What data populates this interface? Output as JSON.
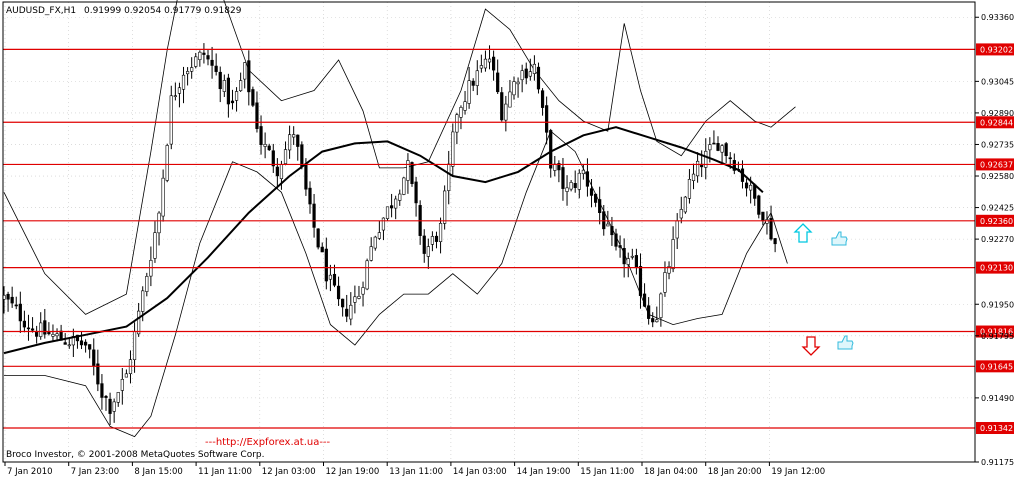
{
  "header": {
    "symbol": "AUDUSD_FX,H1",
    "ohlc": "0.91999 0.92054 0.91779 0.91829"
  },
  "footer": {
    "copyright": "Broco Investor, © 2001-2008 MetaQuotes Software Corp.",
    "watermark": "---http://Expforex.at.ua---"
  },
  "colors": {
    "candle": "#000000",
    "level_line": "#e00000",
    "label_bg": "#e00000",
    "grid": "#c8c8c8",
    "up_arrow": "#00c8e0",
    "down_arrow": "#e00000",
    "hand": "#33bbdd"
  },
  "icons": {
    "up": "arrow-up-icon",
    "down": "arrow-down-icon",
    "hand": "thumb-up-hand-icon"
  },
  "chart_data": {
    "type": "candlestick",
    "ylim": [
      0.91175,
      0.9343
    ],
    "y_ticks": [
      "0.93360",
      "0.93045",
      "0.92890",
      "0.92735",
      "0.92580",
      "0.92425",
      "0.92270",
      "0.91950",
      "0.91795",
      "0.91490",
      "0.91175"
    ],
    "x_ticks": [
      "7 Jan 2010",
      "7 Jan 23:00",
      "8 Jan 15:00",
      "11 Jan 11:00",
      "12 Jan 03:00",
      "12 Jan 19:00",
      "13 Jan 11:00",
      "14 Jan 03:00",
      "14 Jan 19:00",
      "15 Jan 11:00",
      "18 Jan 04:00",
      "18 Jan 20:00",
      "19 Jan 12:00"
    ],
    "levels": [
      "0.93202",
      "0.92844",
      "0.92637",
      "0.92360",
      "0.92130",
      "0.91816",
      "0.91645",
      "0.91342"
    ],
    "bars_count": 190,
    "close_path": [
      [
        0,
        0.9198
      ],
      [
        7,
        0.9183
      ],
      [
        14,
        0.9178
      ],
      [
        20,
        0.9175
      ],
      [
        24,
        0.9152
      ],
      [
        26,
        0.9145
      ],
      [
        30,
        0.916
      ],
      [
        34,
        0.92
      ],
      [
        38,
        0.924
      ],
      [
        41,
        0.9295
      ],
      [
        44,
        0.931
      ],
      [
        49,
        0.9318
      ],
      [
        53,
        0.9305
      ],
      [
        56,
        0.9292
      ],
      [
        59,
        0.931
      ],
      [
        63,
        0.9275
      ],
      [
        67,
        0.9262
      ],
      [
        71,
        0.928
      ],
      [
        75,
        0.924
      ],
      [
        79,
        0.921
      ],
      [
        83,
        0.919
      ],
      [
        87,
        0.92
      ],
      [
        91,
        0.923
      ],
      [
        95,
        0.9245
      ],
      [
        99,
        0.9262
      ],
      [
        103,
        0.922
      ],
      [
        107,
        0.9232
      ],
      [
        111,
        0.929
      ],
      [
        115,
        0.9305
      ],
      [
        119,
        0.9316
      ],
      [
        122,
        0.929
      ],
      [
        126,
        0.9308
      ],
      [
        130,
        0.9312
      ],
      [
        134,
        0.9265
      ],
      [
        138,
        0.925
      ],
      [
        142,
        0.926
      ],
      [
        146,
        0.924
      ],
      [
        150,
        0.922
      ],
      [
        154,
        0.9215
      ],
      [
        158,
        0.919
      ],
      [
        160,
        0.919
      ],
      [
        163,
        0.9215
      ],
      [
        167,
        0.925
      ],
      [
        171,
        0.9265
      ],
      [
        175,
        0.9275
      ],
      [
        179,
        0.9265
      ],
      [
        183,
        0.925
      ],
      [
        186,
        0.924
      ],
      [
        189,
        0.9225
      ],
      [
        192,
        0.92
      ],
      [
        194,
        0.9183
      ]
    ],
    "ma_path": [
      [
        0,
        0.9171
      ],
      [
        10,
        0.9176
      ],
      [
        20,
        0.918
      ],
      [
        30,
        0.9184
      ],
      [
        40,
        0.9198
      ],
      [
        50,
        0.9218
      ],
      [
        60,
        0.924
      ],
      [
        70,
        0.9258
      ],
      [
        78,
        0.927
      ],
      [
        86,
        0.9274
      ],
      [
        94,
        0.9275
      ],
      [
        102,
        0.9268
      ],
      [
        110,
        0.9258
      ],
      [
        118,
        0.9255
      ],
      [
        126,
        0.926
      ],
      [
        134,
        0.927
      ],
      [
        142,
        0.9278
      ],
      [
        150,
        0.9282
      ],
      [
        158,
        0.9277
      ],
      [
        166,
        0.9272
      ],
      [
        174,
        0.9266
      ],
      [
        180,
        0.9261
      ],
      [
        186,
        0.925
      ]
    ],
    "band_upper": [
      [
        0,
        0.925
      ],
      [
        10,
        0.921
      ],
      [
        20,
        0.919
      ],
      [
        30,
        0.92
      ],
      [
        36,
        0.927
      ],
      [
        40,
        0.932
      ],
      [
        44,
        0.936
      ],
      [
        52,
        0.9355
      ],
      [
        60,
        0.931
      ],
      [
        68,
        0.9295
      ],
      [
        76,
        0.93
      ],
      [
        82,
        0.9315
      ],
      [
        88,
        0.929
      ],
      [
        92,
        0.9262
      ],
      [
        98,
        0.9262
      ],
      [
        104,
        0.9265
      ],
      [
        112,
        0.93
      ],
      [
        118,
        0.934
      ],
      [
        124,
        0.933
      ],
      [
        130,
        0.931
      ],
      [
        136,
        0.9295
      ],
      [
        142,
        0.9285
      ],
      [
        148,
        0.928
      ],
      [
        152,
        0.9333
      ],
      [
        156,
        0.93
      ],
      [
        160,
        0.9275
      ],
      [
        166,
        0.9268
      ],
      [
        172,
        0.9285
      ],
      [
        178,
        0.9295
      ],
      [
        184,
        0.9285
      ],
      [
        188,
        0.9282
      ],
      [
        194,
        0.9292
      ]
    ],
    "band_lower": [
      [
        0,
        0.916
      ],
      [
        10,
        0.916
      ],
      [
        20,
        0.9155
      ],
      [
        26,
        0.9135
      ],
      [
        32,
        0.913
      ],
      [
        36,
        0.914
      ],
      [
        42,
        0.918
      ],
      [
        48,
        0.9225
      ],
      [
        56,
        0.9265
      ],
      [
        62,
        0.926
      ],
      [
        68,
        0.925
      ],
      [
        74,
        0.922
      ],
      [
        80,
        0.9185
      ],
      [
        86,
        0.9175
      ],
      [
        92,
        0.919
      ],
      [
        98,
        0.92
      ],
      [
        104,
        0.92
      ],
      [
        110,
        0.921
      ],
      [
        116,
        0.92
      ],
      [
        122,
        0.9215
      ],
      [
        128,
        0.925
      ],
      [
        134,
        0.928
      ],
      [
        140,
        0.927
      ],
      [
        146,
        0.9245
      ],
      [
        152,
        0.922
      ],
      [
        158,
        0.919
      ],
      [
        164,
        0.9185
      ],
      [
        170,
        0.9188
      ],
      [
        176,
        0.919
      ],
      [
        182,
        0.922
      ],
      [
        188,
        0.924
      ],
      [
        192,
        0.9215
      ]
    ]
  }
}
